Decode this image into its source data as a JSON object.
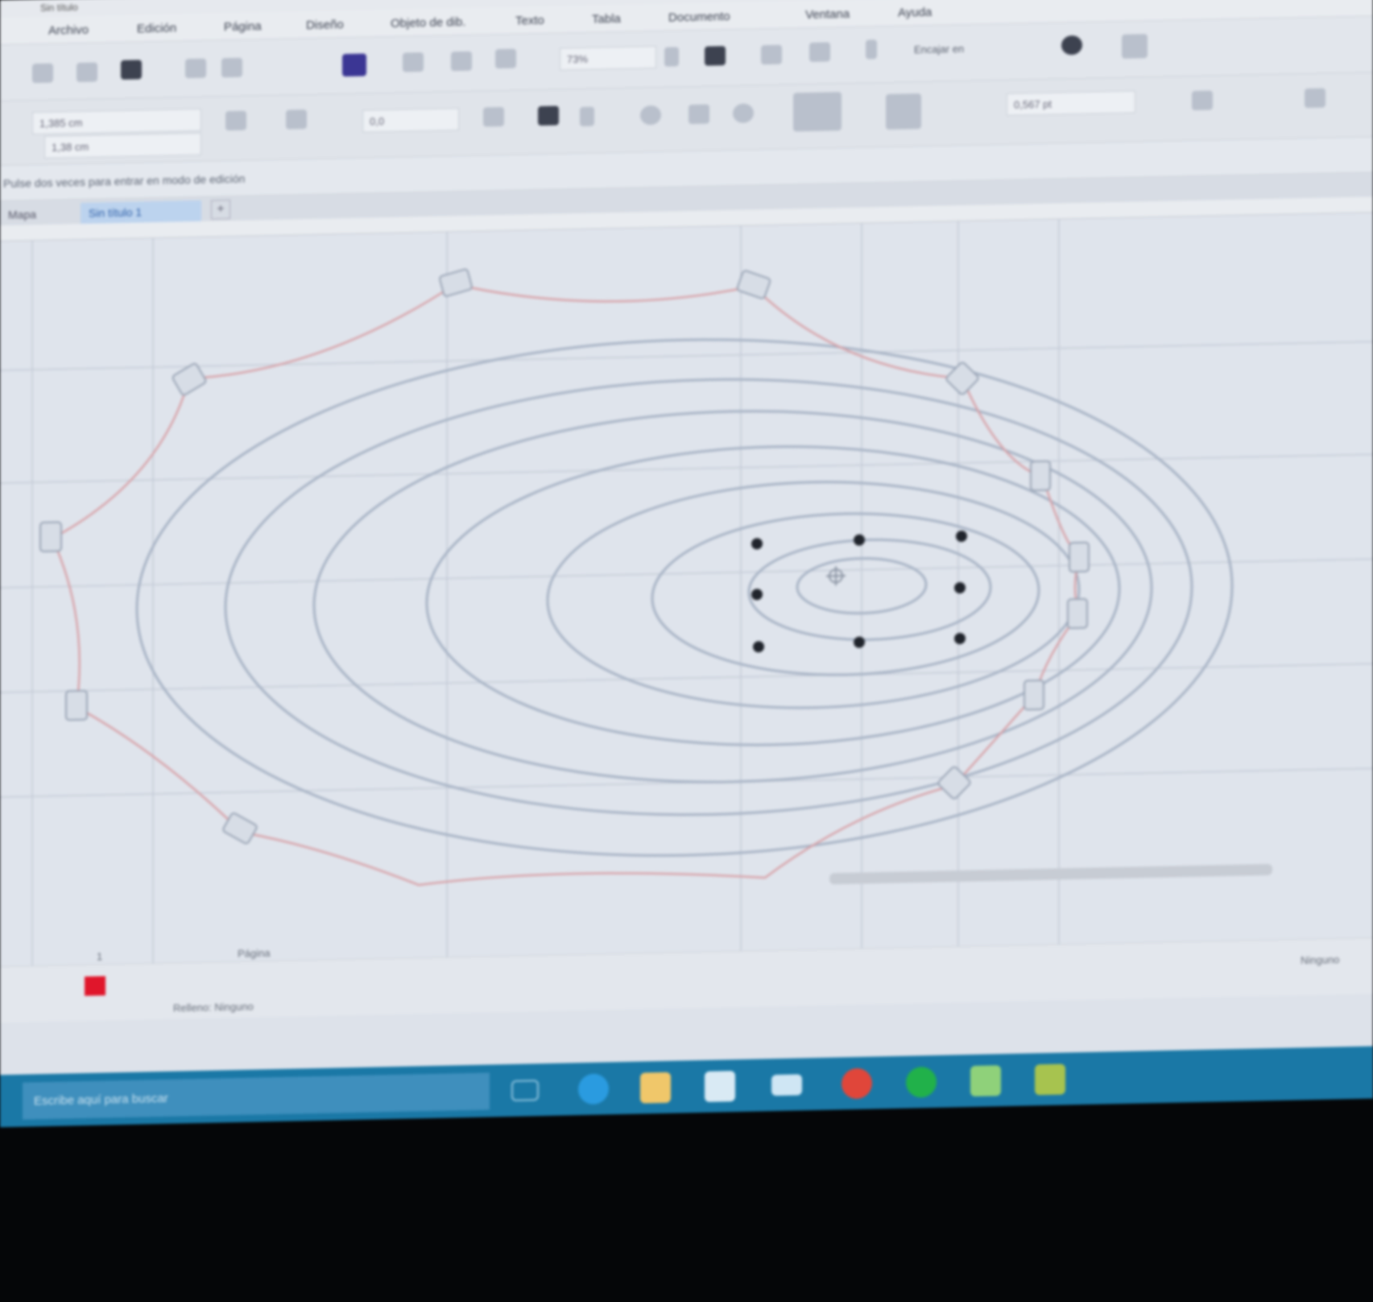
{
  "window": {
    "title": "Sin título"
  },
  "menu": [
    "Archivo",
    "Edición",
    "Página",
    "Diseño",
    "Objeto de dib.",
    "Texto",
    "Tabla",
    "Documento",
    "Ventana",
    "Ayuda"
  ],
  "toolbar": {
    "zoom_value": "73%",
    "snap_label": "Encajar en",
    "size_width": "1,385 cm",
    "size_height": "1,38 cm",
    "angle_value": "0,0",
    "outline_width": "0,567 pt"
  },
  "property_hint": "Pulse dos veces para entrar en modo de edición",
  "tabs": {
    "items": [
      "Mapa",
      "Sin título 1"
    ],
    "add_label": "+"
  },
  "status": {
    "page_label": "Página",
    "page_number": "1",
    "layer_label": "Relleno: Ninguno",
    "zoom_status": "Ninguno"
  },
  "taskbar": {
    "search_placeholder": "Escribe aquí para buscar"
  },
  "colors": {
    "accent_blue": "#1a78a6",
    "fill_swatch": "#e0162b",
    "guide_curve": "#d8a2a8",
    "ellipse_stroke": "#a6b2c4"
  }
}
